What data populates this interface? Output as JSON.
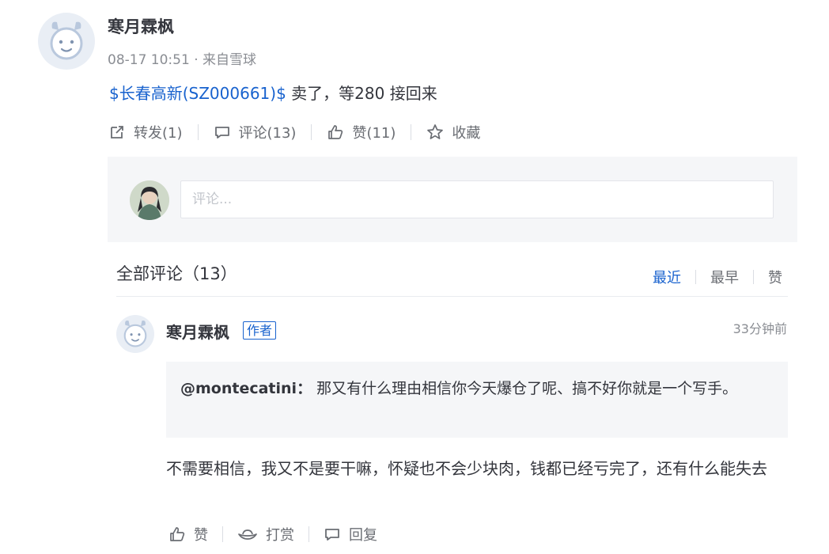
{
  "post": {
    "author": "寒月霖枫",
    "time": "08-17 10:51",
    "separator": "·",
    "source": "来自雪球",
    "stock_link": "$长春高新(SZ000661)$",
    "text": " 卖了，等280 接回来"
  },
  "actions": {
    "forward": "转发(1)",
    "comment": "评论(13)",
    "like": "赞(11)",
    "favorite": "收藏"
  },
  "comment_input": {
    "placeholder": "评论..."
  },
  "comments_section": {
    "title": "全部评论（13）",
    "sort": [
      "最近",
      "最早",
      "赞"
    ],
    "active_sort": "最近"
  },
  "comment": {
    "author": "寒月霖枫",
    "badge": "作者",
    "time": "33分钟前",
    "quote_user": "@montecatini：",
    "quote_text": " 那又有什么理由相信你今天爆仓了呢、搞不好你就是一个写手。",
    "text": "不需要相信，我又不是要干嘛，怀疑也不会少块肉，钱都已经亏完了，还有什么能失去",
    "actions": {
      "like": "赞",
      "tip": "打赏",
      "reply": "回复"
    }
  },
  "colors": {
    "accent": "#1862ce",
    "text": "#33353c",
    "muted": "#8a8d93",
    "panel": "#f5f6f8"
  }
}
